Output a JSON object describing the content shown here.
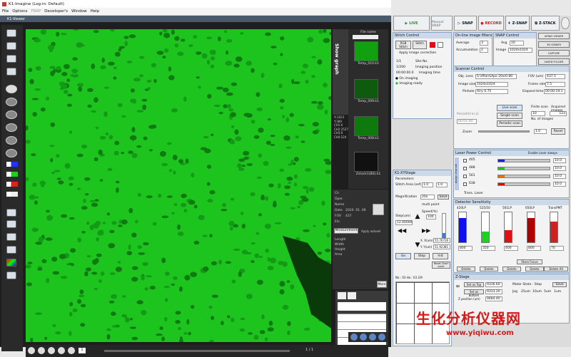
{
  "window": {
    "title": "K1-Imagine (Log-in: Default)"
  },
  "menu": [
    "File",
    "Options",
    "FRAP",
    "Developer's",
    "Window",
    "Help"
  ],
  "viewer": {
    "title": "K1-Viewer"
  },
  "show_graph": "Show graph",
  "file_list": {
    "header": "File name",
    "items": [
      "Temp_010.k1",
      "Temp_009.k1",
      "Temp_008.k1",
      "Zstack1(Bit).k1"
    ]
  },
  "info_lines": [
    "X:1023",
    "Y:389",
    "CH1:0",
    "CH2:2527",
    "CH3:0",
    "CH4:224"
  ],
  "meta": {
    "labels": [
      "Ch",
      "Oper.",
      "Name",
      "Date",
      "FOV",
      "Etc."
    ],
    "date": "2020. 01. 06",
    "fov": "437",
    "measurement_label": "Measurement",
    "apply_label": "Apply autosel",
    "measure_fields": [
      "Length",
      "Width",
      "Height",
      "Area"
    ],
    "more_label": "More"
  },
  "playback": {
    "frame_box": "1",
    "counter": "1 / 1"
  },
  "toolbar_top": {
    "live": "LIVE",
    "manual_snap": "Manual SNAP",
    "snap": "SNAP",
    "record": "RECORD",
    "zsnap": "Z-SNAP",
    "zstack": "Z-STACK"
  },
  "stitch": {
    "title": "Stitch Control",
    "rgb_label": "RGB Stitch",
    "stitch_label": "Stitch",
    "apply_label": "Apply image correction",
    "count": "1/1",
    "site_no_label": "Site No.",
    "positions": "1/200",
    "imaging_position_label": "Imaging position",
    "time": "00:00:00.0",
    "imaging_time_label": "Imaging time",
    "on_imaging": "On imaging",
    "imaging_ready": "Imaging ready"
  },
  "filters": {
    "title": "On-line image filters",
    "average_label": "Average",
    "average_value": "3",
    "accumulation_label": "Accumulation",
    "accumulation_value": "2"
  },
  "snap_control": {
    "title": "SNAP Control",
    "avg_label": "Avg",
    "avg_value": "10",
    "image_label": "Image",
    "image_value": "1024x1024"
  },
  "side_buttons": [
    "ARRAY VIEWER",
    "3D VIEWER",
    "CAPTURE",
    "SAVED FOLDER"
  ],
  "scanner": {
    "title": "Scanner Control",
    "obj_lens_label": "Obj. Lens",
    "obj_lens_value": "S  UPlanSApo 20x/0.80",
    "fov_label": "FOV (um)",
    "fov_value": "437.5",
    "image_size_label": "Image size",
    "image_size_value": "1024x1024",
    "frame_rate_label": "Frame rate",
    "frame_rate_value": "7.5",
    "pinhole_label": "Pinhole",
    "pinhole_value": "Airy 0.75",
    "elapsed_label": "Elapsed time",
    "elapsed_value": "00:00:19.1",
    "live_scan": "Live scan",
    "single_scan": "Single scan",
    "periodic_scan": "Periodic scan",
    "finite_scan_label": "Finite scan",
    "finite_scan_value": "10",
    "no_images_label": "No. of images",
    "acquired_label": "Acquired images",
    "acquired_value": "123",
    "period_label": "Period(H:m:s)",
    "period_value": "00:01:00",
    "zoom_label": "Zoom",
    "zoom_value": "1.0",
    "reset_label": "Reset"
  },
  "laser": {
    "title": "Laser Power Control",
    "enable_label": "Enable Laser always",
    "side_label": "Assign Channel",
    "lines": [
      {
        "name": "405",
        "value": "10.0",
        "color": "#2020d0",
        "level": 0.12
      },
      {
        "name": "488",
        "value": "10.0",
        "color": "#20c020",
        "level": 0.12
      },
      {
        "name": "561",
        "value": "10.0",
        "color": "#e07000",
        "level": 0.12
      },
      {
        "name": "638",
        "value": "10.0",
        "color": "#d01010",
        "level": 0.12
      }
    ],
    "trans_label": "Trans. Laser"
  },
  "detector": {
    "title": "Detector Sensitivity",
    "channels": [
      {
        "name": "420LP",
        "value": "800",
        "color": "#1010f0",
        "level": 0.8
      },
      {
        "name": "525/50",
        "value": "350",
        "color": "#20d020",
        "level": 0.35
      },
      {
        "name": "561LP",
        "value": "400",
        "color": "#e01010",
        "level": 0.4
      },
      {
        "name": "650LP",
        "value": "800",
        "color": "#b00000",
        "level": 0.8
      },
      {
        "name": "TransPMT",
        "value": "70",
        "color": "#cc2222",
        "level": 0.7
      }
    ],
    "delete_label": "Delete",
    "store_label": "Store Focus",
    "delete_all_label": "Delete All"
  },
  "kvstage": {
    "title": "K1-XYStage",
    "parameters": "Parameters",
    "stitch_area_label": "Stitch Area (sef)",
    "stitch_area_values": [
      "1.0",
      "1.0"
    ],
    "magnification_label": "Magnification",
    "mag_value": "20x",
    "save_label": "Save",
    "multi_point_label": "multi point",
    "step_label": "Step(um)",
    "step_value": "12.00000",
    "speed_label": "Speed(%)",
    "speed_value": "100",
    "x_label": "X. X(um)",
    "x_value": "55.76726",
    "y_label": "Y. Y(um)",
    "y_value": "51.92381",
    "go_label": "Go",
    "stop_label": "Stop",
    "init_label": "Init",
    "reset_label": "Reset Chart point",
    "counter": "No : 03  Ho : 03   2/9"
  },
  "zstage": {
    "title": "Z-Stage",
    "set_top": "Set as Top",
    "top_value": "9336.60",
    "set_bottom": "Set as Bottom",
    "bottom_value": "9333.20",
    "z_position_label": "Z position (um)",
    "z_position_value": "9484.40",
    "motor_state_label": "Motor State : Stop",
    "save_label": "Save",
    "jog_label": "Jog",
    "jog_values": [
      "25um",
      "10um",
      "5um",
      "1um"
    ]
  },
  "watermark": {
    "line1": "生化分析仪器网",
    "line2": "www.yiqiwu.com"
  }
}
